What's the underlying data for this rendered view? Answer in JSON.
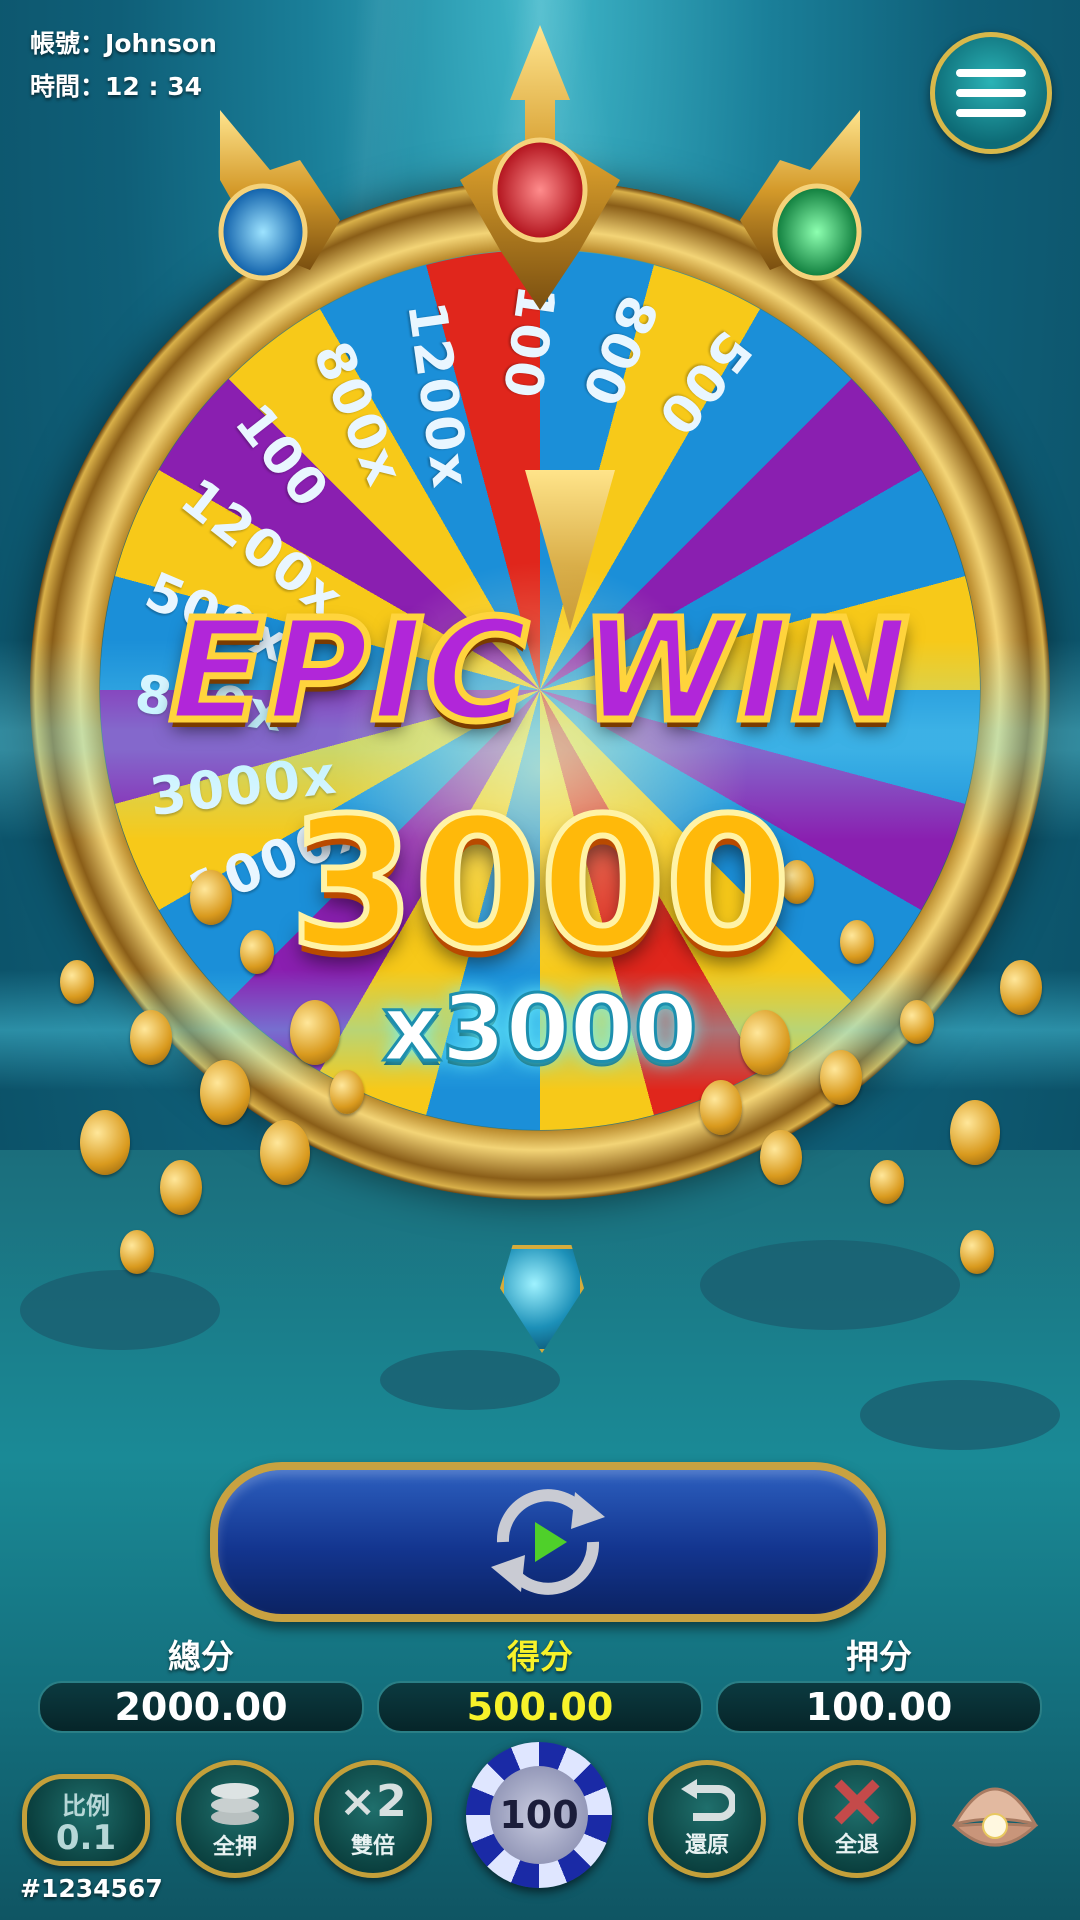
{
  "hud": {
    "account_label": "帳號：",
    "account_value": "Johnson",
    "time_label": "時間：",
    "time_value": "12 : 34"
  },
  "menu": {
    "icon": "hamburger-menu-icon"
  },
  "wheel": {
    "segments": [
      "1000x",
      "3000x",
      "800x",
      "500x",
      "1200x",
      "100",
      "800x",
      "1200x",
      "100",
      "800",
      "500"
    ]
  },
  "win": {
    "title": "EPIC WIN",
    "amount": "3000",
    "multiplier": "x3000"
  },
  "spin_button": {
    "icon": "autospin-play-icon"
  },
  "scores": {
    "total_label": "總分",
    "total_value": "2000.00",
    "win_label": "得分",
    "win_value": "500.00",
    "bet_label": "押分",
    "bet_value": "100.00"
  },
  "controls": {
    "ratio_label": "比例",
    "ratio_value": "0.1",
    "all_in_label": "全押",
    "double_symbol": "×2",
    "double_label": "雙倍",
    "chip_value": "100",
    "undo_label": "還原",
    "clear_label": "全退"
  },
  "serial": "#1234567",
  "colors": {
    "accent_gold": "#c8a241",
    "win_yellow": "#f7f22a",
    "epic_purple": "#b126d9",
    "spin_blue": "#13358f"
  }
}
